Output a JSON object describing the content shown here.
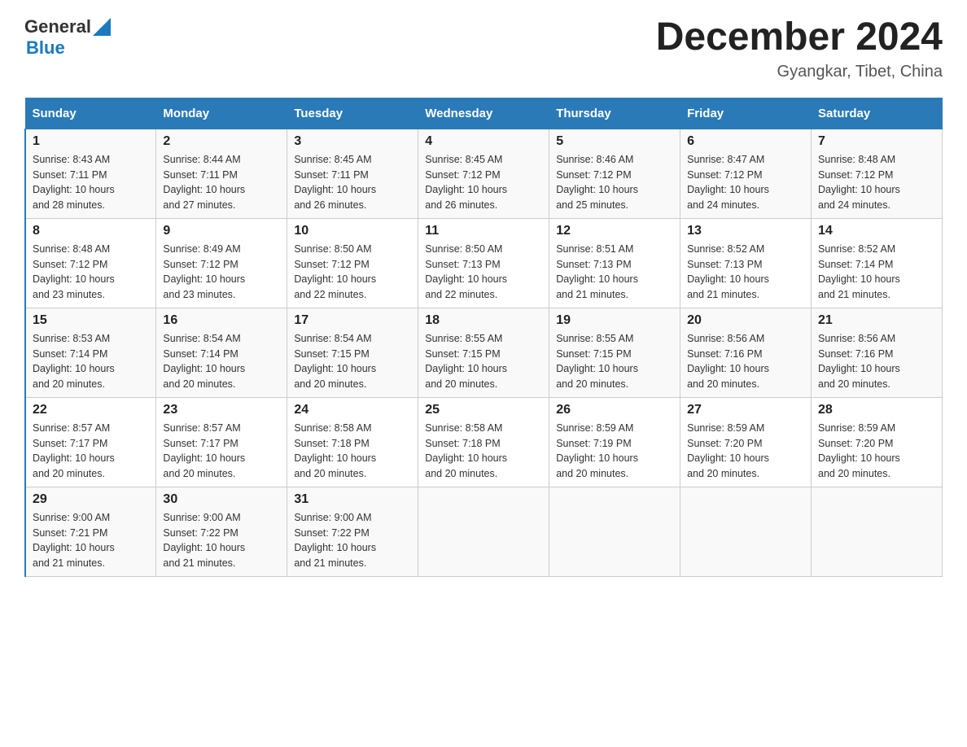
{
  "header": {
    "logo_general": "General",
    "logo_blue": "Blue",
    "title": "December 2024",
    "subtitle": "Gyangkar, Tibet, China"
  },
  "weekdays": [
    "Sunday",
    "Monday",
    "Tuesday",
    "Wednesday",
    "Thursday",
    "Friday",
    "Saturday"
  ],
  "weeks": [
    [
      {
        "day": "1",
        "sunrise": "8:43 AM",
        "sunset": "7:11 PM",
        "daylight": "10 hours and 28 minutes."
      },
      {
        "day": "2",
        "sunrise": "8:44 AM",
        "sunset": "7:11 PM",
        "daylight": "10 hours and 27 minutes."
      },
      {
        "day": "3",
        "sunrise": "8:45 AM",
        "sunset": "7:11 PM",
        "daylight": "10 hours and 26 minutes."
      },
      {
        "day": "4",
        "sunrise": "8:45 AM",
        "sunset": "7:12 PM",
        "daylight": "10 hours and 26 minutes."
      },
      {
        "day": "5",
        "sunrise": "8:46 AM",
        "sunset": "7:12 PM",
        "daylight": "10 hours and 25 minutes."
      },
      {
        "day": "6",
        "sunrise": "8:47 AM",
        "sunset": "7:12 PM",
        "daylight": "10 hours and 24 minutes."
      },
      {
        "day": "7",
        "sunrise": "8:48 AM",
        "sunset": "7:12 PM",
        "daylight": "10 hours and 24 minutes."
      }
    ],
    [
      {
        "day": "8",
        "sunrise": "8:48 AM",
        "sunset": "7:12 PM",
        "daylight": "10 hours and 23 minutes."
      },
      {
        "day": "9",
        "sunrise": "8:49 AM",
        "sunset": "7:12 PM",
        "daylight": "10 hours and 23 minutes."
      },
      {
        "day": "10",
        "sunrise": "8:50 AM",
        "sunset": "7:12 PM",
        "daylight": "10 hours and 22 minutes."
      },
      {
        "day": "11",
        "sunrise": "8:50 AM",
        "sunset": "7:13 PM",
        "daylight": "10 hours and 22 minutes."
      },
      {
        "day": "12",
        "sunrise": "8:51 AM",
        "sunset": "7:13 PM",
        "daylight": "10 hours and 21 minutes."
      },
      {
        "day": "13",
        "sunrise": "8:52 AM",
        "sunset": "7:13 PM",
        "daylight": "10 hours and 21 minutes."
      },
      {
        "day": "14",
        "sunrise": "8:52 AM",
        "sunset": "7:14 PM",
        "daylight": "10 hours and 21 minutes."
      }
    ],
    [
      {
        "day": "15",
        "sunrise": "8:53 AM",
        "sunset": "7:14 PM",
        "daylight": "10 hours and 20 minutes."
      },
      {
        "day": "16",
        "sunrise": "8:54 AM",
        "sunset": "7:14 PM",
        "daylight": "10 hours and 20 minutes."
      },
      {
        "day": "17",
        "sunrise": "8:54 AM",
        "sunset": "7:15 PM",
        "daylight": "10 hours and 20 minutes."
      },
      {
        "day": "18",
        "sunrise": "8:55 AM",
        "sunset": "7:15 PM",
        "daylight": "10 hours and 20 minutes."
      },
      {
        "day": "19",
        "sunrise": "8:55 AM",
        "sunset": "7:15 PM",
        "daylight": "10 hours and 20 minutes."
      },
      {
        "day": "20",
        "sunrise": "8:56 AM",
        "sunset": "7:16 PM",
        "daylight": "10 hours and 20 minutes."
      },
      {
        "day": "21",
        "sunrise": "8:56 AM",
        "sunset": "7:16 PM",
        "daylight": "10 hours and 20 minutes."
      }
    ],
    [
      {
        "day": "22",
        "sunrise": "8:57 AM",
        "sunset": "7:17 PM",
        "daylight": "10 hours and 20 minutes."
      },
      {
        "day": "23",
        "sunrise": "8:57 AM",
        "sunset": "7:17 PM",
        "daylight": "10 hours and 20 minutes."
      },
      {
        "day": "24",
        "sunrise": "8:58 AM",
        "sunset": "7:18 PM",
        "daylight": "10 hours and 20 minutes."
      },
      {
        "day": "25",
        "sunrise": "8:58 AM",
        "sunset": "7:18 PM",
        "daylight": "10 hours and 20 minutes."
      },
      {
        "day": "26",
        "sunrise": "8:59 AM",
        "sunset": "7:19 PM",
        "daylight": "10 hours and 20 minutes."
      },
      {
        "day": "27",
        "sunrise": "8:59 AM",
        "sunset": "7:20 PM",
        "daylight": "10 hours and 20 minutes."
      },
      {
        "day": "28",
        "sunrise": "8:59 AM",
        "sunset": "7:20 PM",
        "daylight": "10 hours and 20 minutes."
      }
    ],
    [
      {
        "day": "29",
        "sunrise": "9:00 AM",
        "sunset": "7:21 PM",
        "daylight": "10 hours and 21 minutes."
      },
      {
        "day": "30",
        "sunrise": "9:00 AM",
        "sunset": "7:22 PM",
        "daylight": "10 hours and 21 minutes."
      },
      {
        "day": "31",
        "sunrise": "9:00 AM",
        "sunset": "7:22 PM",
        "daylight": "10 hours and 21 minutes."
      },
      null,
      null,
      null,
      null
    ]
  ],
  "labels": {
    "sunrise": "Sunrise:",
    "sunset": "Sunset:",
    "daylight": "Daylight:"
  }
}
